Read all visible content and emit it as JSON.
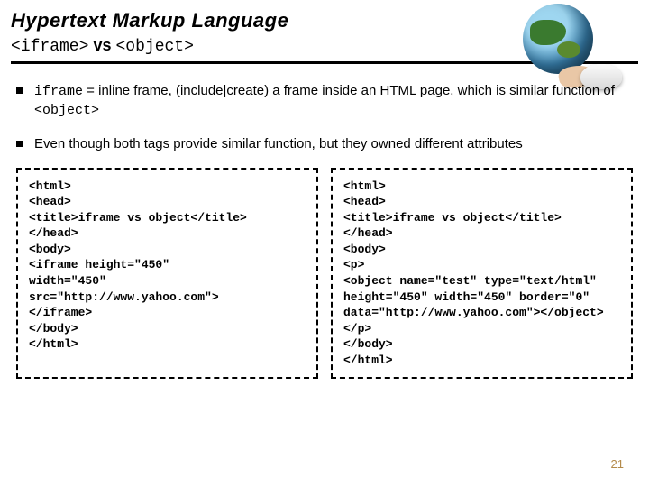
{
  "header": {
    "title": "Hypertext Markup Language",
    "sub_iframe": "<iframe>",
    "sub_vs": "vs",
    "sub_object": "<object>"
  },
  "bullets": [
    {
      "code": "iframe",
      "rest": " = inline frame, (include|create) a frame inside an HTML page, which is similar function of ",
      "tail_code": "<object>"
    },
    {
      "text": "Even though both tags provide similar function, but they owned different attributes"
    }
  ],
  "code_left": "<html>\n<head>\n<title>iframe vs object</title>\n</head>\n<body>\n<iframe height=\"450\"\nwidth=\"450\"\nsrc=\"http://www.yahoo.com\">\n</iframe>\n</body>\n</html>",
  "code_right": "<html>\n<head>\n<title>iframe vs object</title>\n</head>\n<body>\n<p>\n<object name=\"test\" type=\"text/html\" height=\"450\" width=\"450\" border=\"0\" data=\"http://www.yahoo.com\"></object>\n</p>\n</body>\n</html>",
  "page_number": "21"
}
